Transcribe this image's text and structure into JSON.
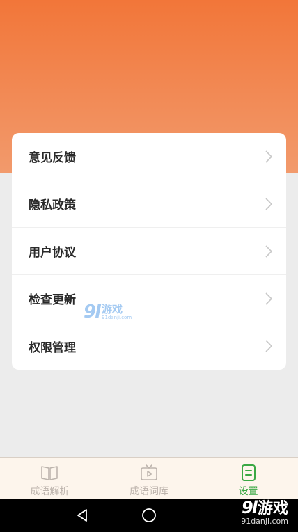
{
  "settings": {
    "items": [
      {
        "label": "意见反馈"
      },
      {
        "label": "隐私政策"
      },
      {
        "label": "用户协议"
      },
      {
        "label": "检查更新"
      },
      {
        "label": "权限管理"
      }
    ]
  },
  "tabbar": {
    "tabs": [
      {
        "label": "成语解析",
        "icon": "book-icon",
        "active": false
      },
      {
        "label": "成语词库",
        "icon": "tv-play-icon",
        "active": false
      },
      {
        "label": "设置",
        "icon": "document-icon",
        "active": true
      }
    ]
  },
  "watermark": {
    "logo": "9l",
    "text": "游戏",
    "domain": "91danji.com"
  },
  "colors": {
    "header_top": "#f27639",
    "header_bottom": "#f29a6c",
    "active_tab": "#3aa844",
    "inactive_tab": "#bdb4ad",
    "tabbar_bg": "#fdf5ec",
    "page_bg": "#ececec"
  },
  "navbar": {
    "buttons": [
      "back-icon",
      "home-icon"
    ]
  }
}
